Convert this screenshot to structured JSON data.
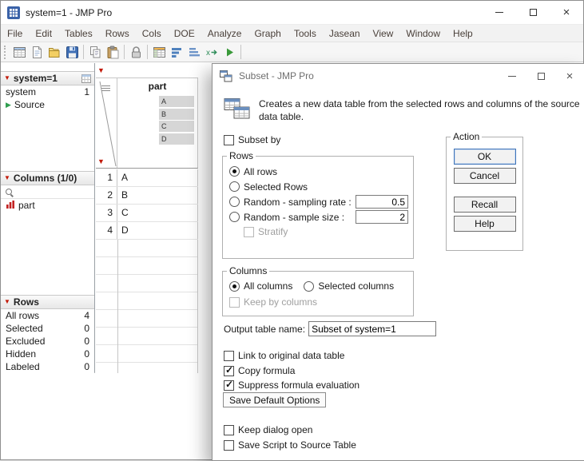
{
  "window": {
    "title": "system=1 - JMP Pro"
  },
  "menu": {
    "items": [
      "File",
      "Edit",
      "Tables",
      "Rows",
      "Cols",
      "DOE",
      "Analyze",
      "Graph",
      "Tools",
      "Jasean",
      "View",
      "Window",
      "Help"
    ]
  },
  "toolbar": {
    "icons": [
      "new-data-table",
      "new-journal",
      "open-file",
      "save",
      "copy",
      "paste",
      "lock",
      "summary-table",
      "distribution",
      "sorted-bars",
      "formula",
      "run-script"
    ]
  },
  "sidebar": {
    "table_panel": {
      "title": "system=1",
      "rows": [
        {
          "label": "system",
          "value": "1"
        }
      ],
      "source_label": "Source"
    },
    "columns_panel": {
      "title": "Columns (1/0)",
      "items": [
        {
          "label": "part"
        }
      ]
    },
    "rows_panel": {
      "title": "Rows",
      "stats": [
        {
          "label": "All rows",
          "value": "4"
        },
        {
          "label": "Selected",
          "value": "0"
        },
        {
          "label": "Excluded",
          "value": "0"
        },
        {
          "label": "Hidden",
          "value": "0"
        },
        {
          "label": "Labeled",
          "value": "0"
        }
      ]
    }
  },
  "grid": {
    "column_header": "part",
    "header_values": [
      "A",
      "B",
      "C",
      "D"
    ],
    "rows": [
      {
        "num": "1",
        "value": "A"
      },
      {
        "num": "2",
        "value": "B"
      },
      {
        "num": "3",
        "value": "C"
      },
      {
        "num": "4",
        "value": "D"
      }
    ]
  },
  "dialog": {
    "title": "Subset - JMP Pro",
    "description": "Creates a new data table from the selected rows and columns of the source data table.",
    "subset_by": {
      "label": "Subset by",
      "checked": false
    },
    "rows_group": {
      "legend": "Rows",
      "options": [
        {
          "label": "All rows",
          "selected": true
        },
        {
          "label": "Selected Rows",
          "selected": false
        },
        {
          "label": "Random - sampling rate :",
          "selected": false,
          "value": "0.5"
        },
        {
          "label": "Random - sample size :",
          "selected": false,
          "value": "2"
        }
      ],
      "stratify_label": "Stratify"
    },
    "action_group": {
      "legend": "Action",
      "buttons": [
        "OK",
        "Cancel",
        "Recall",
        "Help"
      ]
    },
    "columns_group": {
      "legend": "Columns",
      "options": [
        {
          "label": "All columns",
          "selected": true
        },
        {
          "label": "Selected columns",
          "selected": false
        }
      ],
      "keep_by_label": "Keep by columns"
    },
    "output": {
      "label": "Output table name:",
      "value": "Subset of system=1"
    },
    "checkboxes": [
      {
        "label": "Link to original data table",
        "checked": false
      },
      {
        "label": "Copy formula",
        "checked": true
      },
      {
        "label": "Suppress formula evaluation",
        "checked": true
      }
    ],
    "save_default_label": "Save Default Options",
    "bottom_checkboxes": [
      {
        "label": "Keep dialog open",
        "checked": false
      },
      {
        "label": "Save Script to Source Table",
        "checked": false
      }
    ]
  }
}
